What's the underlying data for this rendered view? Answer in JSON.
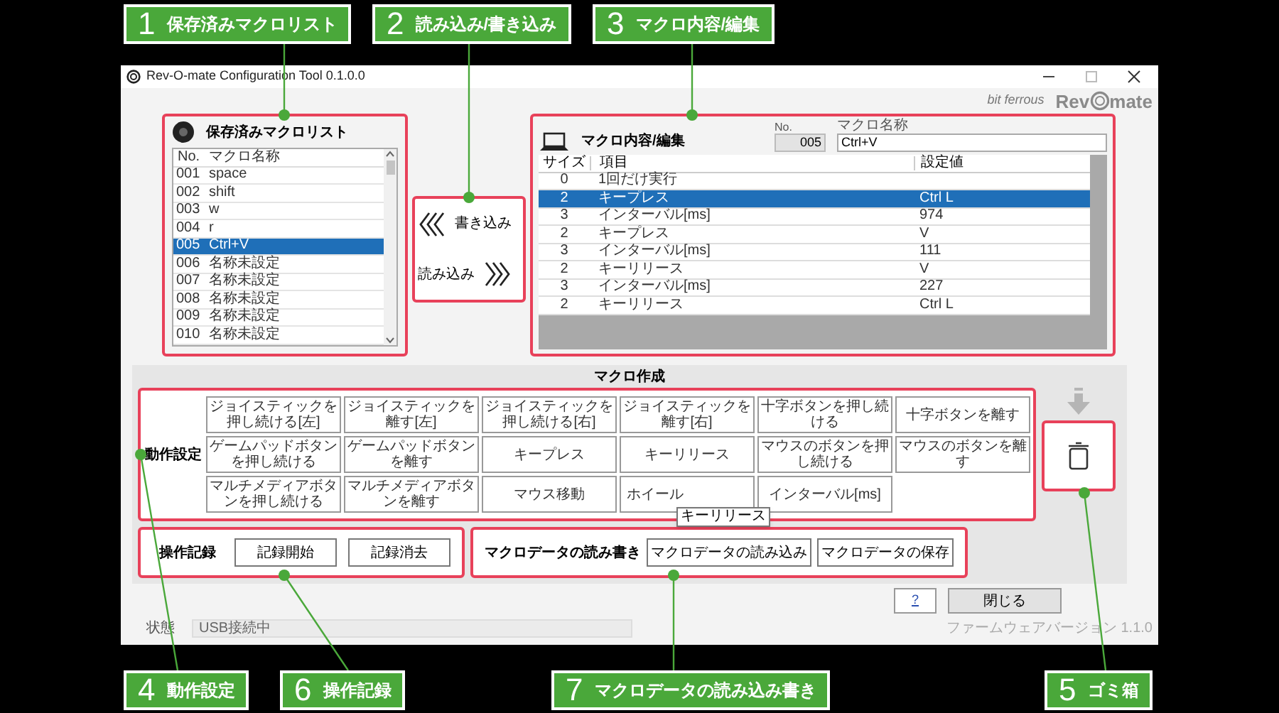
{
  "top_callouts": [
    {
      "number": "1",
      "label": "保存済みマクロリスト"
    },
    {
      "number": "2",
      "label": "読み込み/書き込み"
    },
    {
      "number": "3",
      "label": "マクロ内容/編集"
    }
  ],
  "bottom_callouts": [
    {
      "number": "4",
      "label": "動作設定"
    },
    {
      "number": "6",
      "label": "操作記録"
    },
    {
      "number": "7",
      "label": "マクロデータの読み込み書き"
    },
    {
      "number": "5",
      "label": "ゴミ箱"
    }
  ],
  "window": {
    "title": "Rev-O-mate Configuration Tool 0.1.0.0"
  },
  "logo": {
    "maker": "bit ferrous",
    "product_left": "Rev",
    "product_right": "mate"
  },
  "macro_list": {
    "title": "保存済みマクロリスト",
    "columns": [
      "No.",
      "マクロ名称"
    ],
    "rows": [
      {
        "no": "001",
        "name": "space",
        "selected": false
      },
      {
        "no": "002",
        "name": "shift",
        "selected": false
      },
      {
        "no": "003",
        "name": "w",
        "selected": false
      },
      {
        "no": "004",
        "name": "r",
        "selected": false
      },
      {
        "no": "005",
        "name": "Ctrl+V",
        "selected": true
      },
      {
        "no": "006",
        "name": "名称未設定",
        "selected": false
      },
      {
        "no": "007",
        "name": "名称未設定",
        "selected": false
      },
      {
        "no": "008",
        "name": "名称未設定",
        "selected": false
      },
      {
        "no": "009",
        "name": "名称未設定",
        "selected": false
      },
      {
        "no": "010",
        "name": "名称未設定",
        "selected": false
      }
    ]
  },
  "transfer": {
    "write": "書き込み",
    "read": "読み込み"
  },
  "macro_editor": {
    "title": "マクロ内容/編集",
    "no_label": "No.",
    "no_value": "005",
    "name_label": "マクロ名称",
    "name_value": "Ctrl+V",
    "columns": [
      "サイズ",
      "項目",
      "設定値"
    ],
    "rows": [
      {
        "size": "0",
        "item": "1回だけ実行",
        "selected": false
      },
      {
        "size": "2",
        "item": "キープレス",
        "value": "Ctrl L",
        "selected": true
      },
      {
        "size": "3",
        "item": "インターバル[ms]",
        "value": "974",
        "selected": false
      },
      {
        "size": "2",
        "item": "キープレス",
        "value": "V",
        "selected": false
      },
      {
        "size": "3",
        "item": "インターバル[ms]",
        "value": "111",
        "selected": false
      },
      {
        "size": "2",
        "item": "キーリリース",
        "value": "V",
        "selected": false
      },
      {
        "size": "3",
        "item": "インターバル[ms]",
        "value": "227",
        "selected": false
      },
      {
        "size": "2",
        "item": "キーリリース",
        "value": "Ctrl L",
        "selected": false
      }
    ]
  },
  "macro_create": {
    "title": "マクロ作成",
    "action_label": "動作設定",
    "buttons": [
      "ジョイスティックを押し続ける[左]",
      "ジョイスティックを離す[左]",
      "ジョイスティックを押し続ける[右]",
      "ジョイスティックを離す[右]",
      "十字ボタンを押し続ける",
      "十字ボタンを離す",
      "ゲームパッドボタンを押し続ける",
      "ゲームパッドボタンを離す",
      "キープレス",
      "キーリリース",
      "マウスのボタンを押し続ける",
      "マウスのボタンを離す",
      "マルチメディアボタンを押し続ける",
      "マルチメディアボタンを離す",
      "マウス移動",
      "ホイール",
      "インターバル[ms]"
    ],
    "tooltip": "キーリリース"
  },
  "recording": {
    "label": "操作記録",
    "buttons": [
      "記録開始",
      "記録消去"
    ]
  },
  "macro_data": {
    "label": "マクロデータの読み書き",
    "buttons": [
      "マクロデータの読み込み",
      "マクロデータの保存"
    ]
  },
  "help_button": "?",
  "close_button": "閉じる",
  "status": {
    "label": "状態",
    "value": "USB接続中"
  },
  "firmware": "ファームウェアバージョン 1.1.0"
}
